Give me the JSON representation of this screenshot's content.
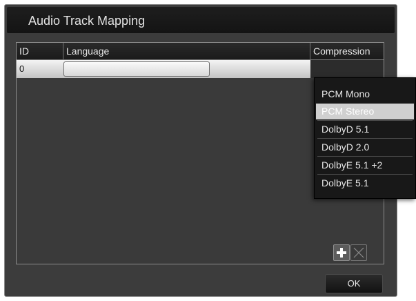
{
  "dialog": {
    "title": "Audio Track Mapping",
    "ok_label": "OK"
  },
  "grid": {
    "columns": [
      "ID",
      "Language",
      "Compression"
    ],
    "rows": [
      {
        "id": "0",
        "language": "",
        "compression": ""
      }
    ]
  },
  "toolbar": {
    "add_icon": "plus-icon",
    "delete_icon": "x-icon"
  },
  "compression_dropdown": {
    "options": [
      "PCM Mono",
      "PCM Stereo",
      "DolbyD 5.1",
      "DolbyD 2.0",
      "DolbyE 5.1 +2",
      "DolbyE 5.1"
    ],
    "highlighted": "PCM Stereo"
  },
  "colors": {
    "dialog_bg": "#3c3c3c",
    "title_bg": "#1a1a1a",
    "row_selected": "#d8d8d8",
    "dropdown_bg": "#181818",
    "dropdown_highlight": "#d0d0d0"
  }
}
